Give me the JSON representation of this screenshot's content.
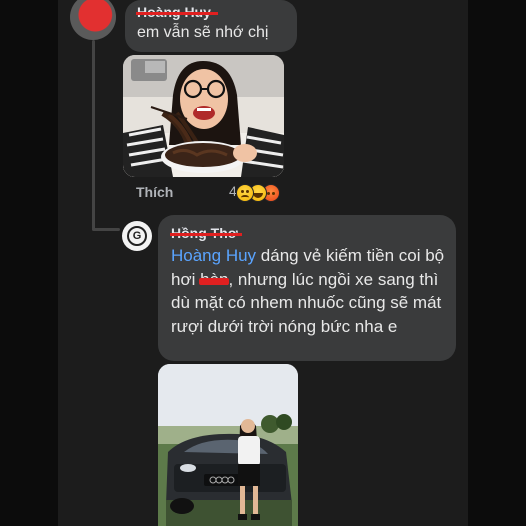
{
  "comments": [
    {
      "author": "Hoàng Huy",
      "text": "em vẫn sẽ nhớ chị",
      "actions": {
        "like_label": "Thích",
        "reaction_count": "4"
      },
      "reactions": [
        "sad-emoji-icon",
        "haha-emoji-icon",
        "angry-emoji-icon"
      ]
    },
    {
      "author": "Hồng Thơ",
      "mention": "Hoàng Huy",
      "text_part1": " dáng vẻ kiếm tiền coi bộ hơi ",
      "redacted_word": "hèn",
      "text_part2": ", nhưng lúc ngồi xe sang thì dù mặt có nhem nhuốc cũng sẽ mát rượi dưới trời nóng bức nha e"
    }
  ],
  "colors": {
    "bubble": "#3a3b3c",
    "mention": "#5aa4ff",
    "redaction": "#e02020",
    "background": "#1c1c1c"
  }
}
